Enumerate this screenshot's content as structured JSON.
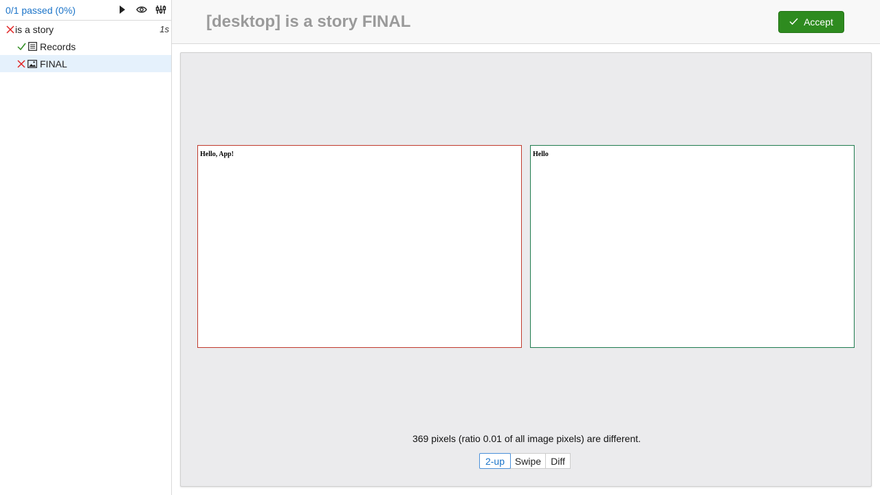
{
  "sidebar": {
    "summary": "0/1 passed (0%)",
    "header_icons": [
      "play-icon",
      "eye-icon",
      "settings-sliders-icon"
    ],
    "tree": [
      {
        "label": "is a story",
        "status": "failed",
        "duration": "1s"
      },
      {
        "label": "Records",
        "status": "passed",
        "type": "list-icon"
      },
      {
        "label": "FINAL",
        "status": "failed",
        "type": "image-icon",
        "selected": true
      }
    ]
  },
  "main": {
    "title": "[desktop] is a story FINAL",
    "accept_label": "Accept",
    "actual_text": "Hello, App!",
    "expected_text": "Hello",
    "diff_message": "369 pixels (ratio 0.01 of all image pixels) are different.",
    "modes": [
      "2-up",
      "Swipe",
      "Diff"
    ],
    "active_mode": "2-up"
  },
  "colors": {
    "fail": "#e02020",
    "pass": "#2e8b1f",
    "link": "#1a73c8",
    "actual_border": "#c0392b",
    "expected_border": "#1e7b4e"
  }
}
